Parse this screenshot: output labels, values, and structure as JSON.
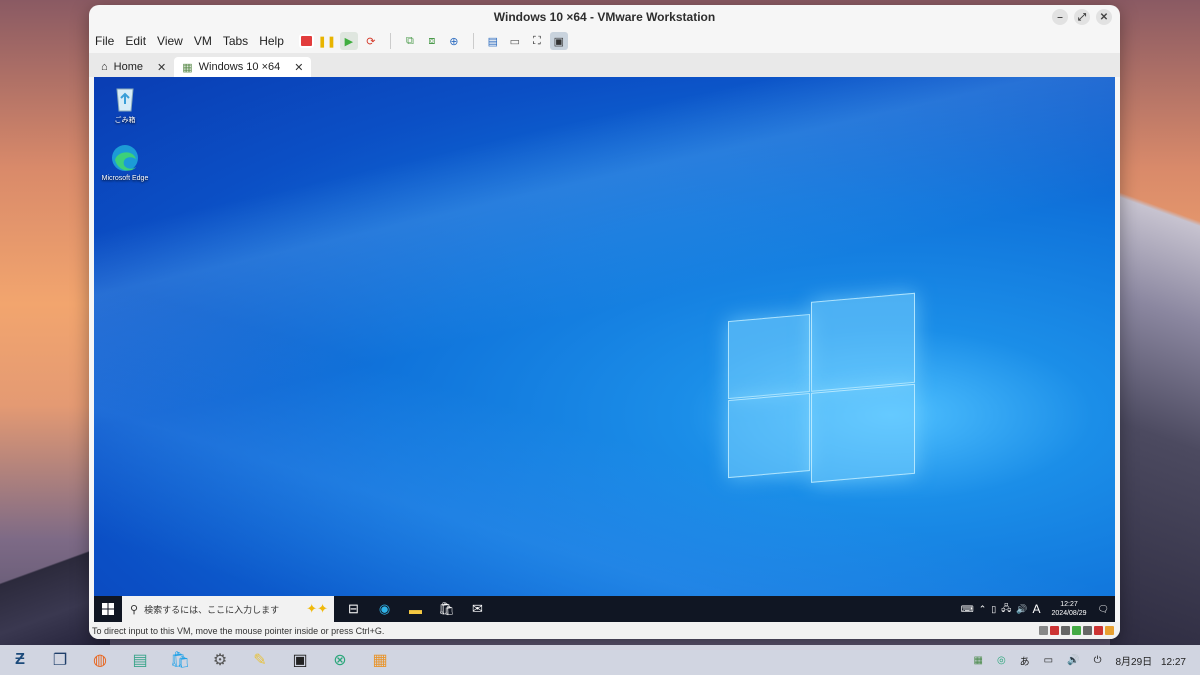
{
  "window": {
    "title": "Windows 10 ×64 - VMware Workstation",
    "controls": [
      "–",
      "⤢",
      "✕"
    ]
  },
  "menu": [
    "File",
    "Edit",
    "View",
    "VM",
    "Tabs",
    "Help"
  ],
  "tabs": [
    {
      "label": "Home",
      "icon": "home-icon"
    },
    {
      "label": "Windows 10 ×64",
      "icon": "vm-icon",
      "active": true
    }
  ],
  "guest": {
    "desktop_icons": [
      {
        "label": "ごみ箱",
        "icon": "recycle-bin-icon"
      },
      {
        "label": "Microsoft Edge",
        "icon": "edge-icon"
      }
    ],
    "taskbar": {
      "search_placeholder": "検索するには、ここに入力します",
      "tray_ime": "A",
      "clock_time": "12:27",
      "clock_date": "2024/08/29"
    }
  },
  "statusbar": {
    "message": "To direct input to this VM, move the mouse pointer inside or press Ctrl+G."
  },
  "host_tray": {
    "ime": "あ",
    "date": "8月29日",
    "time": "12:27"
  },
  "colors": {
    "accent": "#0b6fd8",
    "guest_taskbar": "#101623"
  }
}
